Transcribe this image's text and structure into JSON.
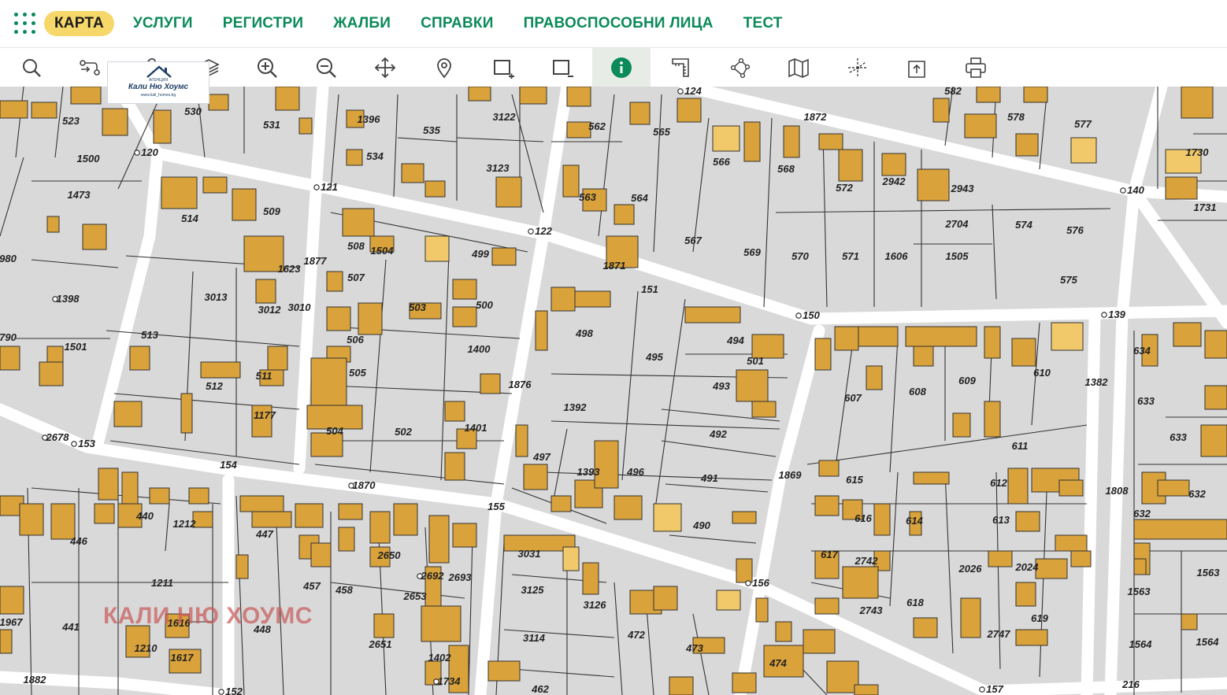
{
  "nav": {
    "items": [
      {
        "label": "КАРТА",
        "active": true
      },
      {
        "label": "УСЛУГИ"
      },
      {
        "label": "РЕГИСТРИ"
      },
      {
        "label": "ЖАЛБИ"
      },
      {
        "label": "СПРАВКИ"
      },
      {
        "label": "ПРАВОСПОСОБНИ ЛИЦА"
      },
      {
        "label": "ТЕСТ"
      }
    ]
  },
  "toolbar": {
    "tools": [
      {
        "icon": "search-icon"
      },
      {
        "icon": "route-icon"
      },
      {
        "icon": "link-icon"
      },
      {
        "icon": "layers-icon"
      },
      {
        "icon": "zoom-in-icon"
      },
      {
        "icon": "zoom-out-icon"
      },
      {
        "icon": "pan-icon"
      },
      {
        "icon": "location-pin-icon"
      },
      {
        "icon": "select-add-icon"
      },
      {
        "icon": "select-remove-icon"
      },
      {
        "icon": "info-icon",
        "active": true
      },
      {
        "icon": "measure-icon"
      },
      {
        "icon": "polygon-icon"
      },
      {
        "icon": "map-icon"
      },
      {
        "icon": "coordinates-icon"
      },
      {
        "icon": "export-icon"
      },
      {
        "icon": "print-icon"
      }
    ]
  },
  "logo": {
    "top": "АГЕНЦИЯ",
    "name": "Кали Ню Хоумс",
    "url": "www.kali_homes.bg"
  },
  "watermark": "КАЛИ НЮ ХОУМС",
  "map": {
    "highlight_parcel": "501",
    "parcel_labels": [
      "523",
      "530",
      "531",
      "1396",
      "535",
      "3122",
      "562",
      "565",
      "124",
      "582",
      "1872",
      "578",
      "577",
      "1730",
      "120",
      "1500",
      "534",
      "3123",
      "566",
      "568",
      "2942",
      "2943",
      "140",
      "1731",
      "1473",
      "121",
      "509",
      "514",
      "563",
      "564",
      "572",
      "2704",
      "574",
      "576",
      "122",
      "980",
      "508",
      "1504",
      "499",
      "567",
      "569",
      "570",
      "571",
      "1606",
      "1505",
      "1877",
      "1623",
      "507",
      "1871",
      "575",
      "3013",
      "3012",
      "3010",
      "503",
      "500",
      "151",
      "150",
      "139",
      "1398",
      "790",
      "1501",
      "513",
      "506",
      "498",
      "495",
      "494",
      "634",
      "1400",
      "1382",
      "505",
      "511",
      "493",
      "607",
      "608",
      "609",
      "610",
      "512",
      "1876",
      "501",
      "1392",
      "1177",
      "633",
      "492",
      "611",
      "1401",
      "633",
      "504",
      "502",
      "2678",
      "153",
      "497",
      "1393",
      "496",
      "154",
      "491",
      "1869",
      "615",
      "612",
      "632",
      "1808",
      "1870",
      "155",
      "440",
      "1212",
      "616",
      "613",
      "446",
      "447",
      "490",
      "632",
      "3031",
      "2650",
      "2742",
      "614",
      "617",
      "2024",
      "2692",
      "2693",
      "1563",
      "457",
      "458",
      "2026",
      "1211",
      "156",
      "1563",
      "3125",
      "2653",
      "618",
      "2743",
      "1967",
      "1616",
      "3126",
      "472",
      "441",
      "448",
      "619",
      "2747",
      "2651",
      "3114",
      "1564",
      "1564",
      "1210",
      "1402",
      "473",
      "474",
      "1617",
      "1882",
      "1734",
      "216",
      "462",
      "157",
      "152"
    ]
  }
}
